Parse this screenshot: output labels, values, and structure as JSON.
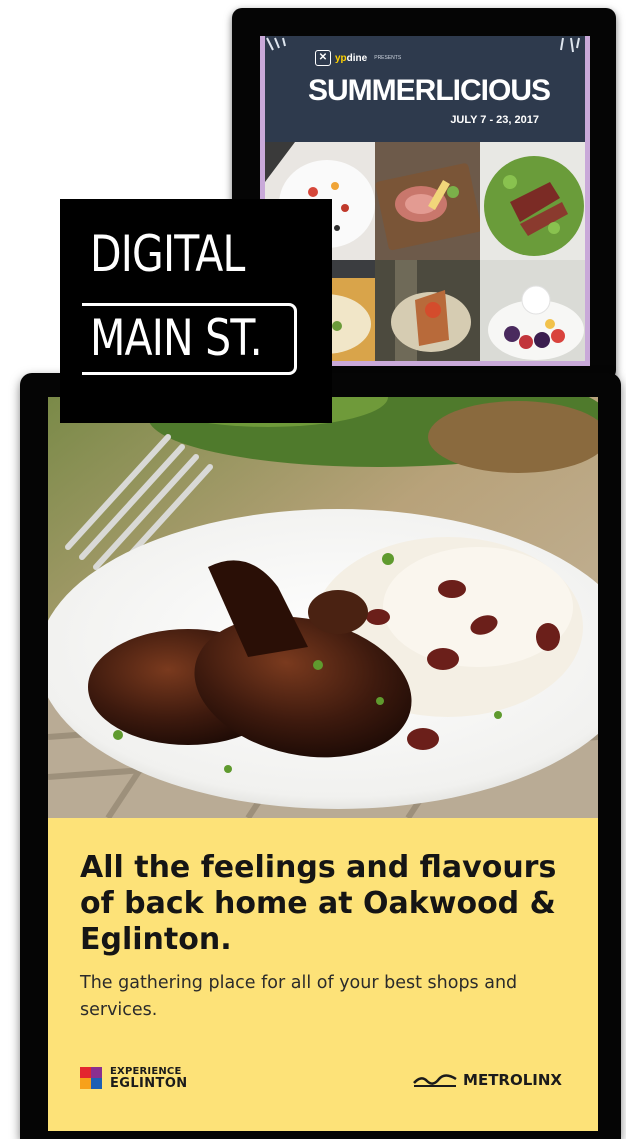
{
  "summerlicious": {
    "brand_prefix": "yp",
    "brand_suffix": "dine",
    "brand_tag": "PRESENTS",
    "title": "SUMMERLICIOUS",
    "dates": "JULY 7 - 23, 2017"
  },
  "digital_main_st": {
    "line1": "DIGITAL",
    "line2": "MAIN ST."
  },
  "poster": {
    "headline": "All the feelings and flavours of back home at Oakwood & Eglinton.",
    "subline": "The gathering place for all of your best shops and services.",
    "experience_line1": "EXPERIENCE",
    "experience_line2": "EGLINTON",
    "metrolinx": "METROLINX"
  },
  "colors": {
    "poster_yellow": "#fde278",
    "summer_navy": "#2e3a4d",
    "summer_lilac": "#c9a9d9"
  },
  "icons": [
    "experience-eglinton-logo-icon",
    "metrolinx-logo-icon",
    "yp-dine-logo-icon"
  ]
}
